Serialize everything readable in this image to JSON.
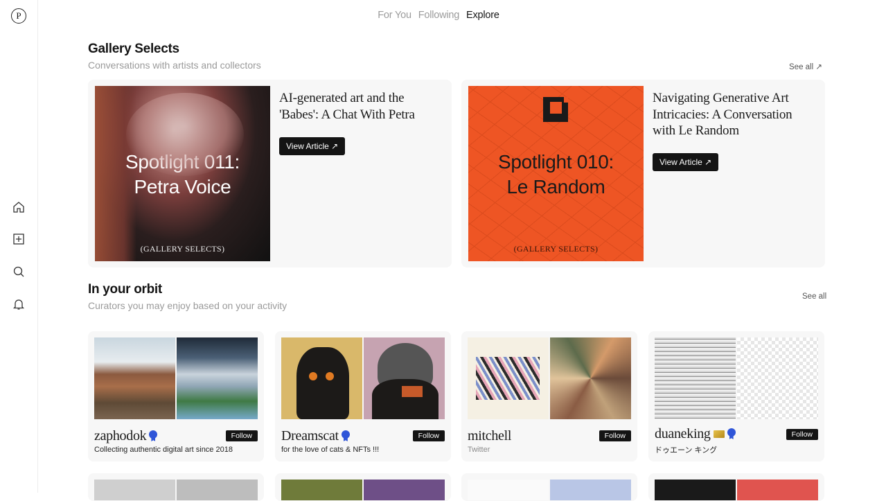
{
  "topnav": {
    "tabs": [
      "For You",
      "Following",
      "Explore"
    ],
    "active": "Explore"
  },
  "sidebar": {
    "logo": "P"
  },
  "gallery": {
    "title": "Gallery Selects",
    "subtitle": "Conversations with artists and collectors",
    "see_all": "See all ↗",
    "articles": [
      {
        "art_title_line1": "Spotlight 011:",
        "art_title_line2": "Petra Voice",
        "tag": "(GALLERY SELECTS)",
        "heading": "AI-generated art and the 'Babes': A Chat With Petra",
        "button": "View Article ↗"
      },
      {
        "art_title_line1": "Spotlight 010:",
        "art_title_line2": "Le Random",
        "tag": "(GALLERY SELECTS)",
        "heading": "Navigating Generative Art Intricacies: A Conversation with Le Random",
        "button": "View Article ↗"
      }
    ]
  },
  "orbit": {
    "title": "In your orbit",
    "subtitle": "Curators you may enjoy based on your activity",
    "see_all": "See all",
    "curators": [
      {
        "name": "zaphodok",
        "description": "Collecting authentic digital art since 2018",
        "follow": "Follow"
      },
      {
        "name": "Dreamscat",
        "description": "for the love of cats & NFTs !!!",
        "follow": "Follow"
      },
      {
        "name": "mitchell",
        "description": "Twitter",
        "follow": "Follow"
      },
      {
        "name": "duaneking",
        "description": "ドゥエーン キング",
        "follow": "Follow"
      }
    ]
  },
  "colors": {
    "accent": "#141414",
    "orange": "#ee5524",
    "verified": "#2f55d8",
    "muted": "#9a9a9a"
  }
}
